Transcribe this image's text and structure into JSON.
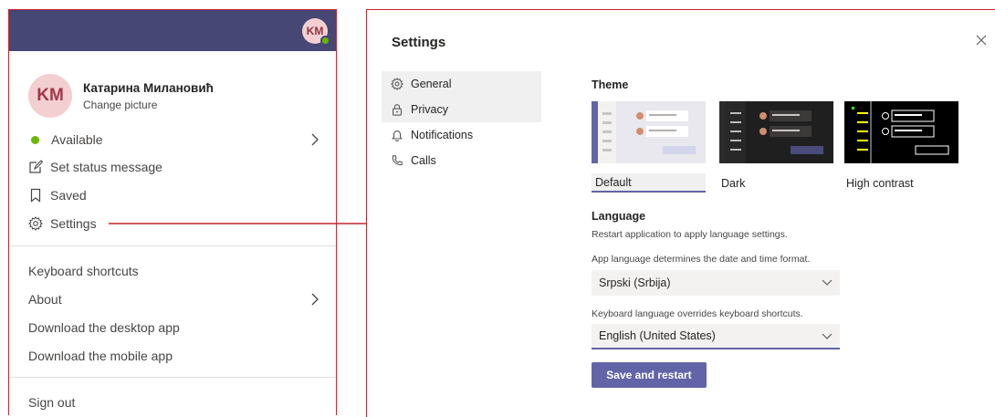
{
  "profile_menu": {
    "header_avatar_initials": "KM",
    "avatar_initials": "KM",
    "name": "Катарина Милановић",
    "change_picture": "Change picture",
    "status": "Available",
    "set_status": "Set status message",
    "saved": "Saved",
    "settings": "Settings",
    "keyboard_shortcuts": "Keyboard shortcuts",
    "about": "About",
    "download_desktop": "Download the desktop app",
    "download_mobile": "Download the mobile app",
    "sign_out": "Sign out"
  },
  "settings": {
    "title": "Settings",
    "nav": [
      "General",
      "Privacy",
      "Notifications",
      "Calls"
    ],
    "theme_heading": "Theme",
    "themes": [
      "Default",
      "Dark",
      "High contrast"
    ],
    "language_heading": "Language",
    "restart_note": "Restart application to apply language settings.",
    "app_language_note": "App language determines the date and time format.",
    "app_language_value": "Srpski (Srbija)",
    "keyboard_language_note": "Keyboard language overrides keyboard shortcuts.",
    "keyboard_language_value": "English (United States)",
    "save_button": "Save and restart"
  },
  "colors": {
    "accent": "#6264a7",
    "header": "#464775",
    "highlight_border": "#c4262e",
    "presence": "#6bb700"
  }
}
